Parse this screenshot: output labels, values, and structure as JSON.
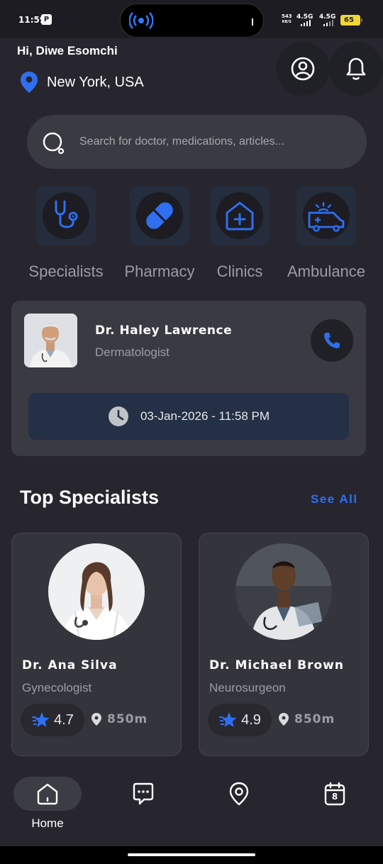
{
  "status_bar": {
    "time": "11:59",
    "speed_value": "543",
    "speed_unit": "KB/S",
    "signal_1": "4.5G",
    "signal_2": "4.5G",
    "battery": "65"
  },
  "header": {
    "greeting": "Hi, Diwe Esomchi",
    "location": "New York, USA",
    "icons": [
      "profile-icon",
      "bell-icon",
      "location-pin-icon"
    ]
  },
  "search": {
    "placeholder": "Search for doctor, medications, articles...",
    "icon": "search-icon"
  },
  "categories": [
    {
      "label": "Specialists",
      "icon": "stethoscope-icon"
    },
    {
      "label": "Pharmacy",
      "icon": "pill-icon"
    },
    {
      "label": "Clinics",
      "icon": "clinic-icon"
    },
    {
      "label": "Ambulance",
      "icon": "ambulance-icon"
    }
  ],
  "appointment": {
    "doctor_name": "Dr. Haley Lawrence",
    "specialty": "Dermatologist",
    "datetime": "03-Jan-2026 - 11:58 PM"
  },
  "top_specialists": {
    "title": "Top Specialists",
    "see_all": "See All",
    "doctors": [
      {
        "name": "Dr. Ana Silva",
        "specialty": "Gynecologist",
        "rating": "4.7",
        "distance": "850m"
      },
      {
        "name": "Dr. Michael Brown",
        "specialty": "Neurosurgeon",
        "rating": "4.9",
        "distance": "850m"
      }
    ]
  },
  "bottom_nav": {
    "home_label": "Home",
    "calendar_day": "8",
    "items": [
      "home-icon",
      "chat-icon",
      "map-pin-icon",
      "calendar-icon"
    ]
  },
  "colors": {
    "background": "#27262e",
    "accent": "#2f6ff0",
    "card": "#3a3a42",
    "appointment_time_bg": "#243045",
    "battery": "#f0d63c"
  }
}
